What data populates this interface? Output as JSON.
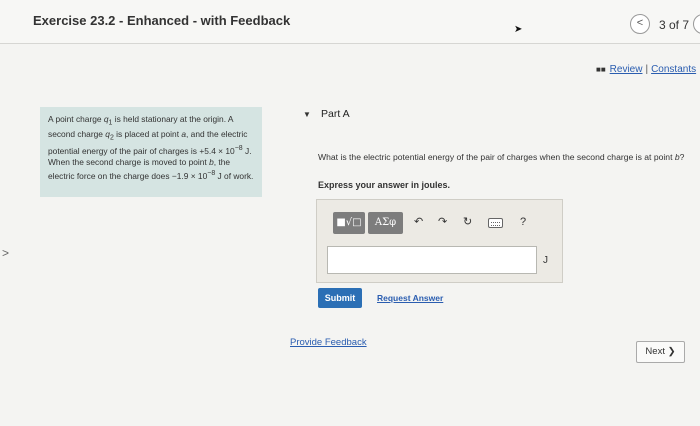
{
  "header": {
    "title": "Exercise 23.2 - Enhanced - with Feedback",
    "prev_glyph": "<",
    "page_count": "3 of 7"
  },
  "links": {
    "review": "Review",
    "separator": "|",
    "constants": "Constants"
  },
  "problem": {
    "p1": "A point charge ",
    "q1": "q",
    "q1_sub": "1",
    "p2": " is held stationary at the origin. A second charge ",
    "q2": "q",
    "q2_sub": "2",
    "p3": " is placed at point ",
    "point_a": "a",
    "p4": ", and the electric potential energy of the pair of charges is ",
    "energy_mantissa": "+5.4 × 10",
    "energy_exp": "−8",
    "energy_unit": " J",
    "p5": ". When the second charge is moved to point ",
    "point_b": "b",
    "p6": ", the electric force on the charge does ",
    "work_mantissa": "−1.9 × 10",
    "work_exp": "−8",
    "work_unit": " J",
    "p7": " of work."
  },
  "part": {
    "toggle_glyph": "▼",
    "label": "Part A",
    "question_text": "What is the electric potential energy of the pair of charges when the second charge is at point ",
    "question_point": "b",
    "question_end": "?",
    "instruction": "Express your answer in joules."
  },
  "toolbar": {
    "templates_label": "■√□",
    "symbols_label": "ΑΣφ",
    "undo_glyph": "↶",
    "redo_glyph": "↷",
    "reset_glyph": "↻",
    "help_glyph": "?"
  },
  "answer": {
    "value": "",
    "unit": "J"
  },
  "actions": {
    "submit_label": "Submit",
    "request_answer_label": "Request Answer",
    "feedback_label": "Provide Feedback",
    "next_label": "Next ❯"
  }
}
